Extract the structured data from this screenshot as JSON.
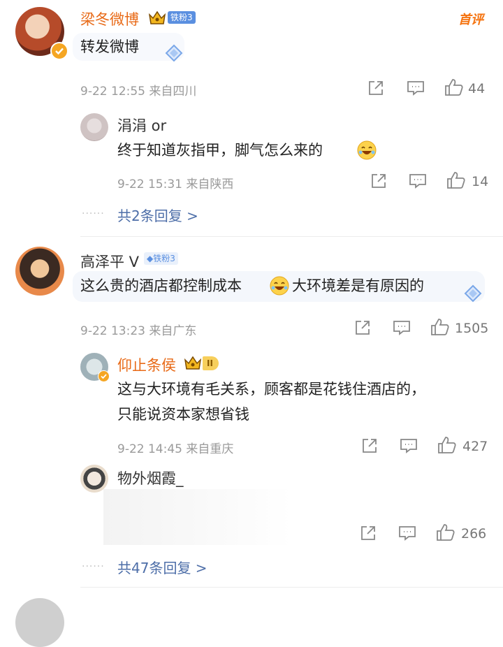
{
  "comments": [
    {
      "user": "梁冬微博",
      "fan_badge": "铁粉3",
      "pinned_label": "首评",
      "text": "转发微博",
      "meta": "9-22 12:55 来自四川",
      "likes": "44",
      "replies": [
        {
          "user": "涓涓 or",
          "text": "终于知道灰指甲，脚气怎么来的",
          "meta": "9-22 15:31 来自陕西",
          "likes": "14"
        }
      ],
      "more_replies": "共2条回复 >"
    },
    {
      "user": "高泽平 V",
      "fan_badge": "铁粉3",
      "text_a": "这么贵的酒店都控制成本",
      "text_b": "大环境差是有原因的",
      "meta": "9-22 13:23 来自广东",
      "likes": "1505",
      "replies": [
        {
          "user": "仰止条侯",
          "level_badge": "II",
          "text_line1": "这与大环境有毛关系，顾客都是花钱住酒店的，",
          "text_line2": "只能说资本家想省钱",
          "meta": "9-22 14:45 来自重庆",
          "likes": "427"
        },
        {
          "user": "物外烟霞_",
          "likes": "266"
        }
      ],
      "more_replies": "共47条回复 >"
    }
  ],
  "colors": {
    "username_orange": "#e86a17",
    "link_blue": "#4d6ea8",
    "meta_gray": "#9a9a9a"
  },
  "icons": [
    "verified-icon",
    "crown-icon",
    "share-icon",
    "comment-icon",
    "like-icon",
    "laugh-emoji-icon",
    "sparkle-icon"
  ]
}
